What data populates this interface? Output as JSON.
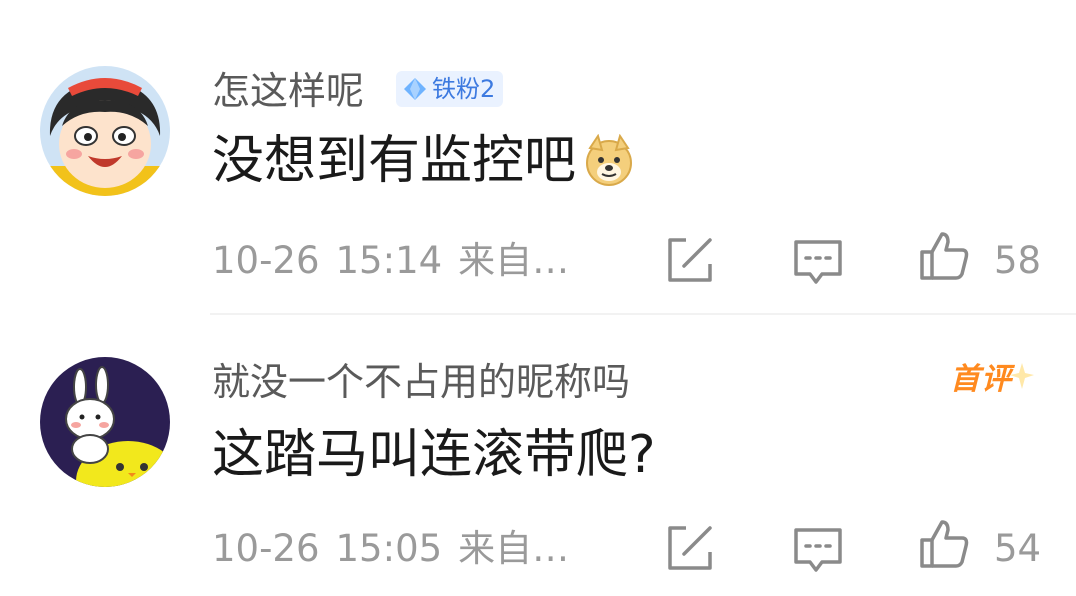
{
  "comments": [
    {
      "username": "怎这样呢",
      "badge": "铁粉2",
      "content": "没想到有监控吧",
      "emoji": "doge-emoji",
      "date": "10-26",
      "time": "15:14",
      "source": "来自…",
      "likes": "58"
    },
    {
      "username": "就没一个不占用的昵称吗",
      "tag": "首评",
      "content": "这踏马叫连滚带爬?",
      "date": "10-26",
      "time": "15:05",
      "source": "来自…",
      "likes": "54"
    }
  ],
  "icons": {
    "share": "share-icon",
    "reply": "comment-icon",
    "like": "thumbs-up-icon"
  },
  "colors": {
    "badge_blue": "#3d7ae0",
    "first_tag_orange": "#ff8a1f",
    "meta_gray": "#9a9a9a"
  }
}
